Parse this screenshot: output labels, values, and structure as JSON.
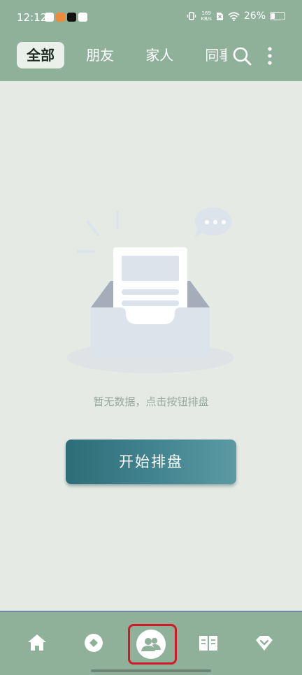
{
  "status_bar": {
    "time": "12:12",
    "net_speed_value": "169",
    "net_speed_unit": "KB/s",
    "battery": "26%"
  },
  "tabs": [
    {
      "label": "全部",
      "active": true
    },
    {
      "label": "朋友",
      "active": false
    },
    {
      "label": "家人",
      "active": false
    },
    {
      "label": "同事",
      "active": false
    }
  ],
  "header_icons": {
    "search": "search-icon",
    "more": "more-vertical-icon"
  },
  "empty_state": {
    "message": "暂无数据，点击按钮排盘",
    "button_label": "开始排盘"
  },
  "bottom_nav": [
    {
      "icon": "home-icon"
    },
    {
      "icon": "compass-icon"
    },
    {
      "icon": "people-icon",
      "selected": true
    },
    {
      "icon": "book-icon"
    },
    {
      "icon": "heart-diamond-icon"
    }
  ],
  "colors": {
    "header": "#8fb19a",
    "background": "#e5eae4",
    "button": "#3b7f8a",
    "highlight": "#d2192b"
  }
}
